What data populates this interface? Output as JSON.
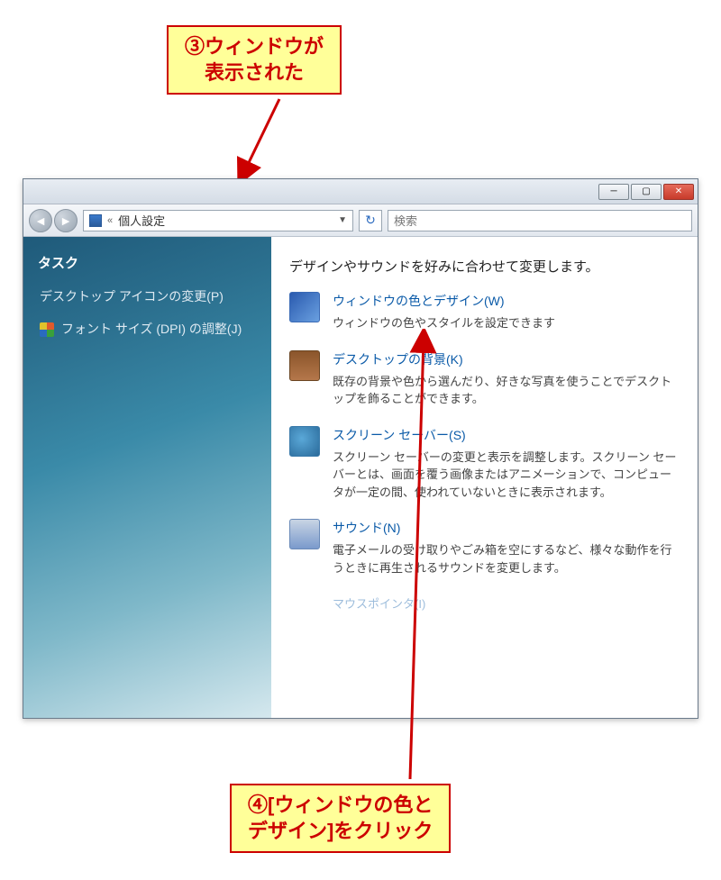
{
  "callouts": {
    "c1_line1": "③ウィンドウが",
    "c1_line2": "表示された",
    "c2_line1": "④[ウィンドウの色と",
    "c2_line2": "デザイン]をクリック"
  },
  "breadcrumb": {
    "separator": "«",
    "location": "個人設定"
  },
  "search": {
    "placeholder": "検索"
  },
  "sidebar": {
    "title": "タスク",
    "links": [
      {
        "label": "デスクトップ アイコンの変更(P)"
      },
      {
        "label": "フォント サイズ (DPI) の調整(J)"
      }
    ]
  },
  "main": {
    "heading": "デザインやサウンドを好みに合わせて変更します。",
    "options": [
      {
        "title": "ウィンドウの色とデザイン(W)",
        "desc": "ウィンドウの色やスタイルを設定できます"
      },
      {
        "title": "デスクトップの背景(K)",
        "desc": "既存の背景や色から選んだり、好きな写真を使うことでデスクトップを飾ることができます。"
      },
      {
        "title": "スクリーン セーバー(S)",
        "desc": "スクリーン セーバーの変更と表示を調整します。スクリーン セーバーとは、画面を覆う画像またはアニメーションで、コンピュータが一定の間、使われていないときに表示されます。"
      },
      {
        "title": "サウンド(N)",
        "desc": "電子メールの受け取りやごみ箱を空にするなど、様々な動作を行うときに再生されるサウンドを変更します。"
      }
    ],
    "cutoff": "マウスポインタ(I)"
  }
}
